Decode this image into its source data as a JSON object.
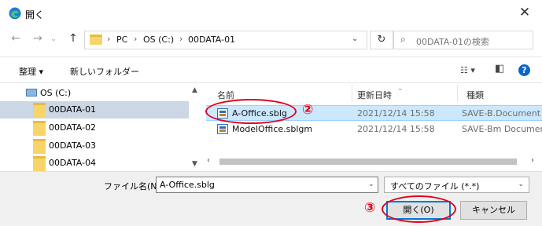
{
  "window": {
    "title": "開く",
    "close_icon": "close-icon",
    "app_icon": "edge-browser-icon"
  },
  "navigation": {
    "back_icon": "back-arrow-icon",
    "forward_icon": "forward-arrow-icon",
    "recent_icon": "chevron-down-icon",
    "up_icon": "up-arrow-icon",
    "breadcrumb": [
      "PC",
      "OS (C:)",
      "00DATA-01"
    ],
    "search_placeholder": "00DATA-01の検索"
  },
  "commands": {
    "organize": "整理 ▾",
    "new_folder": "新しいフォルダー"
  },
  "tree": {
    "drive": "OS (C:)",
    "folders": [
      {
        "label": "00DATA-01",
        "selected": true
      },
      {
        "label": "00DATA-02",
        "selected": false
      },
      {
        "label": "00DATA-03",
        "selected": false
      },
      {
        "label": "00DATA-04",
        "selected": false
      }
    ]
  },
  "file_list": {
    "columns": [
      "名前",
      "更新日時",
      "種類"
    ],
    "rows": [
      {
        "name": "A-Office.sblg",
        "date": "2021/12/14 15:58",
        "type": "SAVE-B.Document",
        "selected": true
      },
      {
        "name": "ModelOffice.sblgm",
        "date": "2021/12/14 15:58",
        "type": "SAVE-Bm Document",
        "selected": false
      }
    ]
  },
  "footer": {
    "filename_label": "ファイル名(N):",
    "filename_value": "A-Office.sblg",
    "filter_value": "すべてのファイル (*.*)",
    "open_button": "開く(O)",
    "cancel_button": "キャンセル"
  },
  "annotations": {
    "mark_2": "②",
    "mark_3": "③",
    "color": "#e3001b"
  },
  "colors": {
    "accent": "#0078d7",
    "selection": "#cce8ff",
    "tree_selection": "#ccd7e5"
  }
}
